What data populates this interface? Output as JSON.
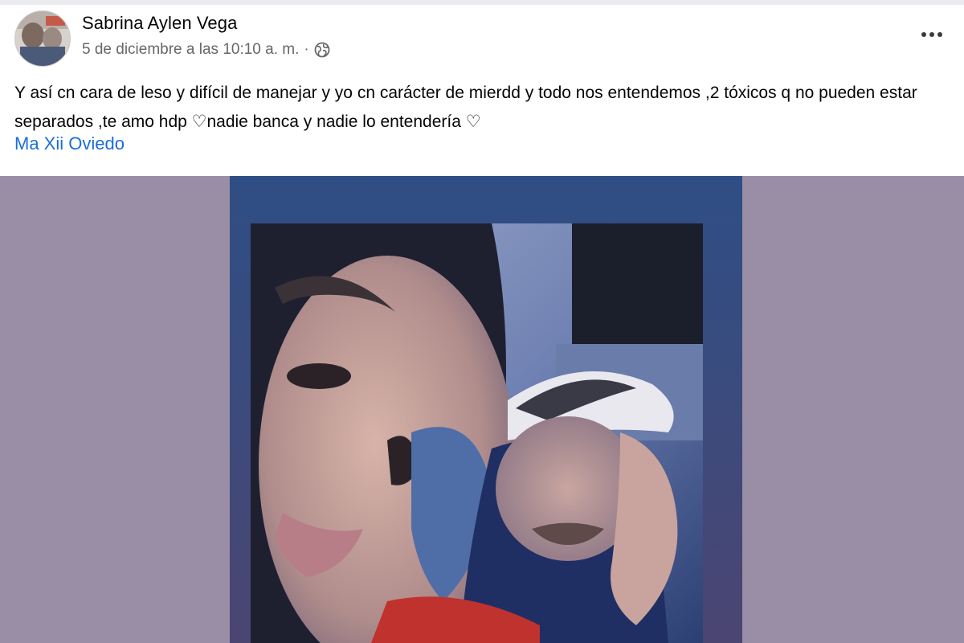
{
  "post": {
    "author_name": "Sabrina Aylen Vega",
    "timestamp": "5 de diciembre a las 10:10 a. m.",
    "separator": "·",
    "privacy_icon": "globe-icon",
    "more_icon": "more-horizontal-icon",
    "text": "Y así cn cara de leso y difícil de manejar y yo cn carácter de mierdd y todo nos entendemos ,2 tóxicos q no pueden estar separados ,te amo hdp ♡nadie banca y nadie lo entendería ♡",
    "tagged_user": "Ma Xii Oviedo"
  },
  "colors": {
    "media_background": "#9a8da6",
    "story_frame": "#2f4e85",
    "link": "#1a6ed8",
    "meta_text": "#65676b"
  }
}
